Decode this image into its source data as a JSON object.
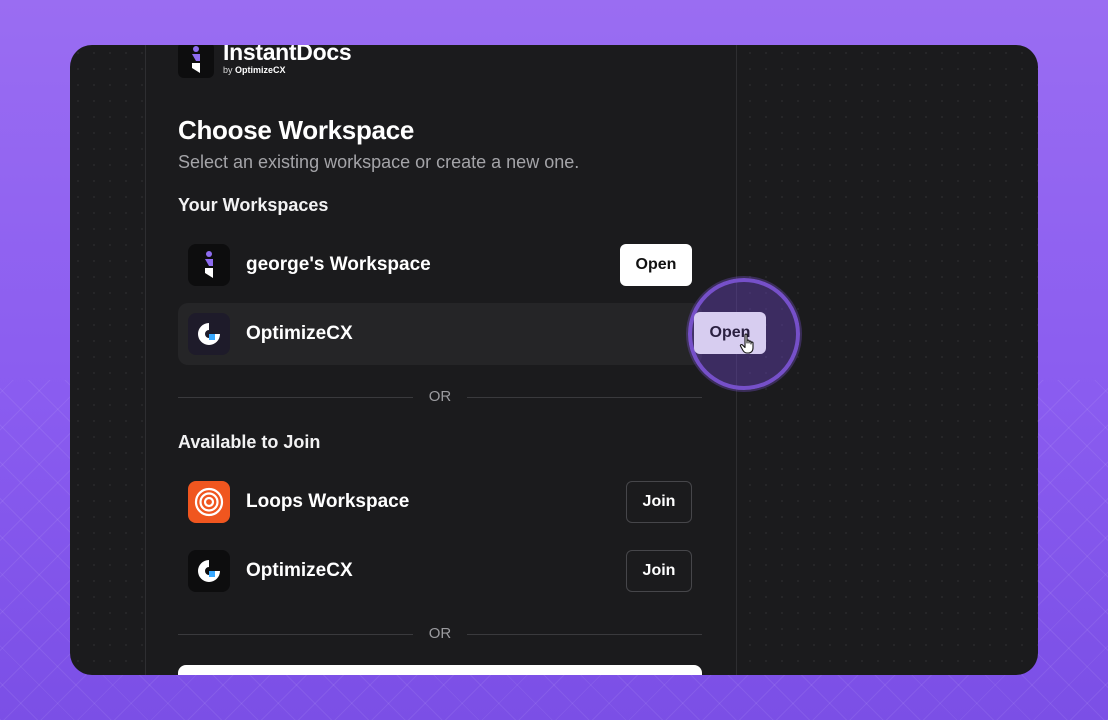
{
  "brand": {
    "name": "InstantDocs",
    "by_prefix": "by",
    "by_name": "OptimizeCX"
  },
  "page": {
    "title": "Choose Workspace",
    "subtitle": "Select an existing workspace or create a new one."
  },
  "your_workspaces": {
    "label": "Your Workspaces",
    "items": [
      {
        "name": "george's Workspace",
        "action": "Open",
        "icon": "instantdocs-logo-icon"
      },
      {
        "name": "OptimizeCX",
        "action": "Open",
        "icon": "optimizecx-logo-icon"
      }
    ]
  },
  "divider_text": "OR",
  "available": {
    "label": "Available to Join",
    "items": [
      {
        "name": "Loops Workspace",
        "action": "Join",
        "icon": "loops-logo-icon"
      },
      {
        "name": "OptimizeCX",
        "action": "Join",
        "icon": "optimizecx-logo-icon"
      }
    ]
  },
  "colors": {
    "background": "#8a5cf0",
    "window": "#1b1b1d",
    "accent": "#7650c9",
    "loops_orange": "#f0561f"
  }
}
